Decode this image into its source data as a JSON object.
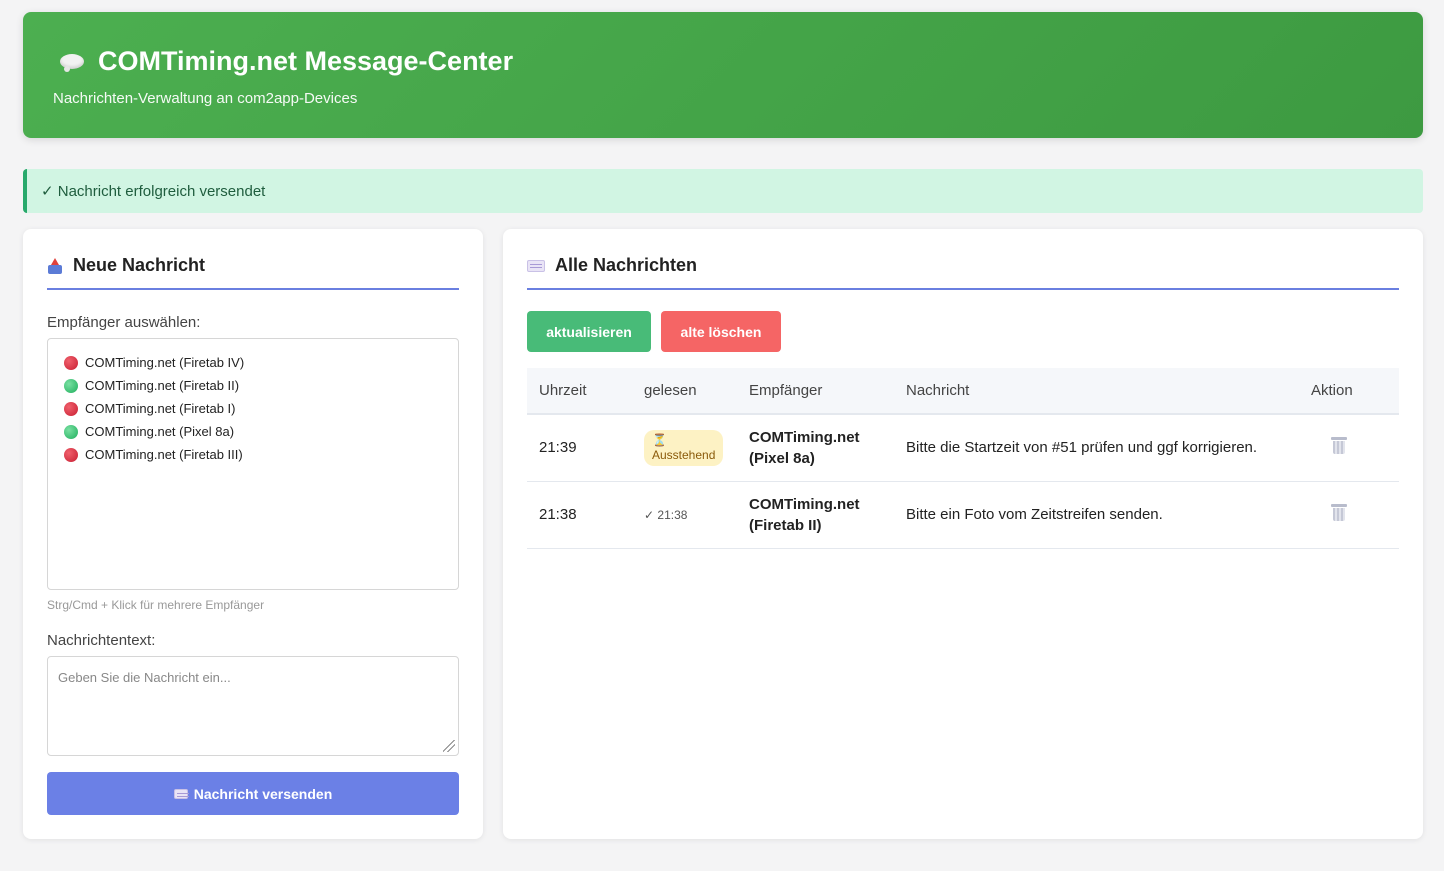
{
  "header": {
    "title": "COMTiming.net Message-Center",
    "subtitle": "Nachrichten-Verwaltung an com2app-Devices",
    "icon": "speech-bubble-icon"
  },
  "alert": {
    "text": "✓ Nachricht erfolgreich versendet"
  },
  "compose": {
    "heading": "Neue Nachricht",
    "recipients_label": "Empfänger auswählen:",
    "recipients": [
      {
        "label": "COMTiming.net (Firetab IV)",
        "status": "red"
      },
      {
        "label": "COMTiming.net (Firetab II)",
        "status": "green"
      },
      {
        "label": "COMTiming.net (Firetab I)",
        "status": "red"
      },
      {
        "label": "COMTiming.net (Pixel 8a)",
        "status": "green"
      },
      {
        "label": "COMTiming.net (Firetab III)",
        "status": "red"
      }
    ],
    "hint": "Strg/Cmd + Klick für mehrere Empfänger",
    "text_label": "Nachrichtentext:",
    "text_placeholder": "Geben Sie die Nachricht ein...",
    "send_label": "Nachricht versenden"
  },
  "messages": {
    "heading": "Alle Nachrichten",
    "refresh_label": "aktualisieren",
    "delete_old_label": "alte löschen",
    "columns": [
      "Uhrzeit",
      "gelesen",
      "Empfänger",
      "Nachricht",
      "Aktion"
    ],
    "rows": [
      {
        "time": "21:39",
        "read_icon": "⏳",
        "read_text": "Ausstehend",
        "recipient_1": "COMTiming.net",
        "recipient_2": "(Pixel 8a)",
        "message": "Bitte die Startzeit von #51 prüfen und ggf korrigieren."
      },
      {
        "time": "21:38",
        "read_icon": "",
        "read_text": "✓ 21:38",
        "recipient_1": "COMTiming.net",
        "recipient_2": "(Firetab II)",
        "message": "Bitte ein Foto vom Zeitstreifen senden."
      }
    ]
  },
  "colors": {
    "header_green": "#4caf50",
    "accent_blue": "#6b80e6",
    "refresh_green": "#48bb78",
    "delete_red": "#f56565",
    "alert_bg": "#d1f5e3"
  }
}
